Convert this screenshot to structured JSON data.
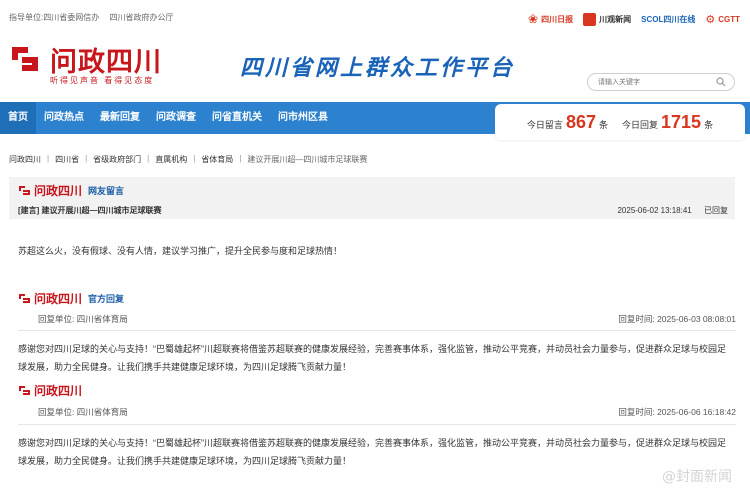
{
  "topbar": {
    "guide_1": "指导单位:四川省委网信办",
    "guide_2": "四川省政府办公厅",
    "partners": [
      {
        "name": "四川日报",
        "color": "#d9361f"
      },
      {
        "name": "川观新闻",
        "color": "#d9361f"
      },
      {
        "name": "SCOL四川在线",
        "color": "#1a63b8"
      },
      {
        "name": "CGTT",
        "color": "#d9361f"
      }
    ]
  },
  "header": {
    "logo_text": "问政四川",
    "logo_sub": "听得见声音 看得见态度",
    "slogan": "四川省网上群众工作平台",
    "search_placeholder": "请输入关键字"
  },
  "nav": {
    "items": [
      {
        "label": "首页"
      },
      {
        "label": "问政热点"
      },
      {
        "label": "最新回复"
      },
      {
        "label": "问政调查"
      },
      {
        "label": "问省直机关"
      },
      {
        "label": "问市州区县"
      }
    ]
  },
  "stats": {
    "today_leave_label": "今日留言",
    "today_leave": "867",
    "today_leave_unit": "条",
    "today_reply_label": "今日回复",
    "today_reply": "1715",
    "today_reply_unit": "条"
  },
  "breadcrumb": [
    "问政四川",
    "四川省",
    "省级政府部门",
    "直属机构",
    "省体育局",
    "建议开展川超—四川城市足球联赛"
  ],
  "leave": {
    "section_tag": "网友留言",
    "title": "[建言] 建议开展川超—四川城市足球联赛",
    "time": "2025-06-02 13:18:41",
    "status": "已回复",
    "content": "苏超这么火，没有假球、没有人情，建议学习推广，提升全民参与度和足球热情！"
  },
  "replies": [
    {
      "section_tag": "官方回复",
      "unit_label": "回复单位:",
      "unit": "四川省体育局",
      "time_label": "回复时间:",
      "time": "2025-06-03 08:08:01",
      "content": "感谢您对四川足球的关心与支持！“巴蜀雄起杯”川超联赛将借鉴苏超联赛的健康发展经验，完善赛事体系，强化监管，推动公平竞赛，并动员社会力量参与，促进群众足球与校园足球发展，助力全民健身。让我们携手共建健康足球环境，为四川足球腾飞贡献力量！"
    },
    {
      "section_tag": "",
      "unit_label": "回复单位:",
      "unit": "四川省体育局",
      "time_label": "回复时间:",
      "time": "2025-06-06 16:18:42",
      "content": "感谢您对四川足球的关心与支持！“巴蜀雄起杯”川超联赛将借鉴苏超联赛的健康发展经验，完善赛事体系，强化监管，推动公平竞赛，并动员社会力量参与，促进群众足球与校园足球发展，助力全民健身。让我们携手共建健康足球环境，为四川足球腾飞贡献力量！"
    }
  ],
  "watermark": "@封面新闻",
  "colors": {
    "brand_red": "#c8161d",
    "nav_blue": "#2d82cf",
    "stat_red": "#d9361f",
    "tag_blue": "#1d5fa8"
  }
}
